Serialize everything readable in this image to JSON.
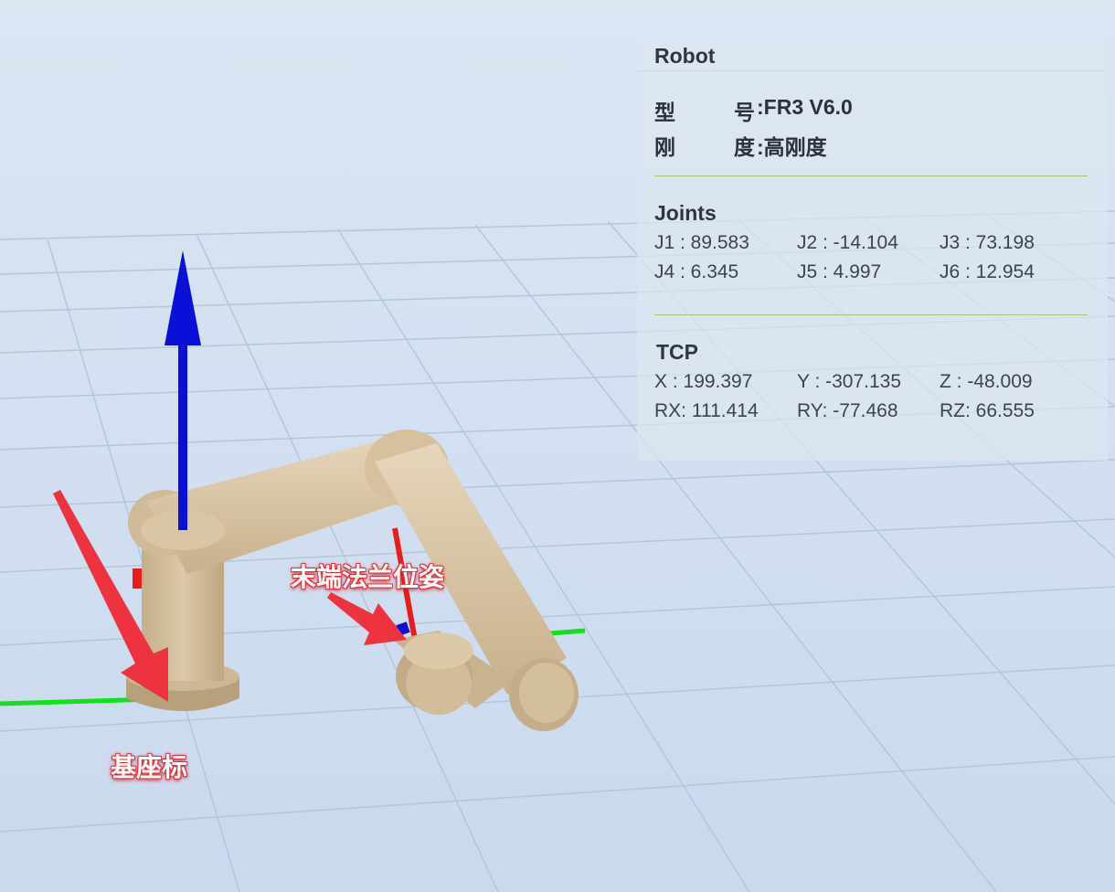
{
  "panel": {
    "title": "Robot",
    "model": {
      "k1": "型",
      "k2": "号",
      "value": ":FR3 V6.0"
    },
    "stiffness": {
      "k1": "刚",
      "k2": "度",
      "value": ":高刚度"
    },
    "joints": {
      "title": "Joints",
      "items": [
        {
          "label": "J1 : 89.583"
        },
        {
          "label": "J2 : -14.104"
        },
        {
          "label": "J3 : 73.198"
        },
        {
          "label": "J4 : 6.345"
        },
        {
          "label": "J5 : 4.997"
        },
        {
          "label": "J6 : 12.954"
        }
      ]
    },
    "tcp": {
      "title": "TCP",
      "items": [
        {
          "label": "X  : 199.397"
        },
        {
          "label": "Y  : -307.135"
        },
        {
          "label": "Z  : -48.009"
        },
        {
          "label": "RX: 111.414"
        },
        {
          "label": "RY: -77.468"
        },
        {
          "label": "RZ: 66.555"
        }
      ]
    }
  },
  "annotations": {
    "flange": "末端法兰位姿",
    "base": "基座标"
  },
  "colors": {
    "axis_z": "#0b10d8",
    "axis_x": "#e81c1c",
    "axis_y": "#14e01c",
    "robot_body": "#d8c4a4",
    "annotation_arrow": "#ee3340",
    "panel_separator": "#a9c56b"
  }
}
